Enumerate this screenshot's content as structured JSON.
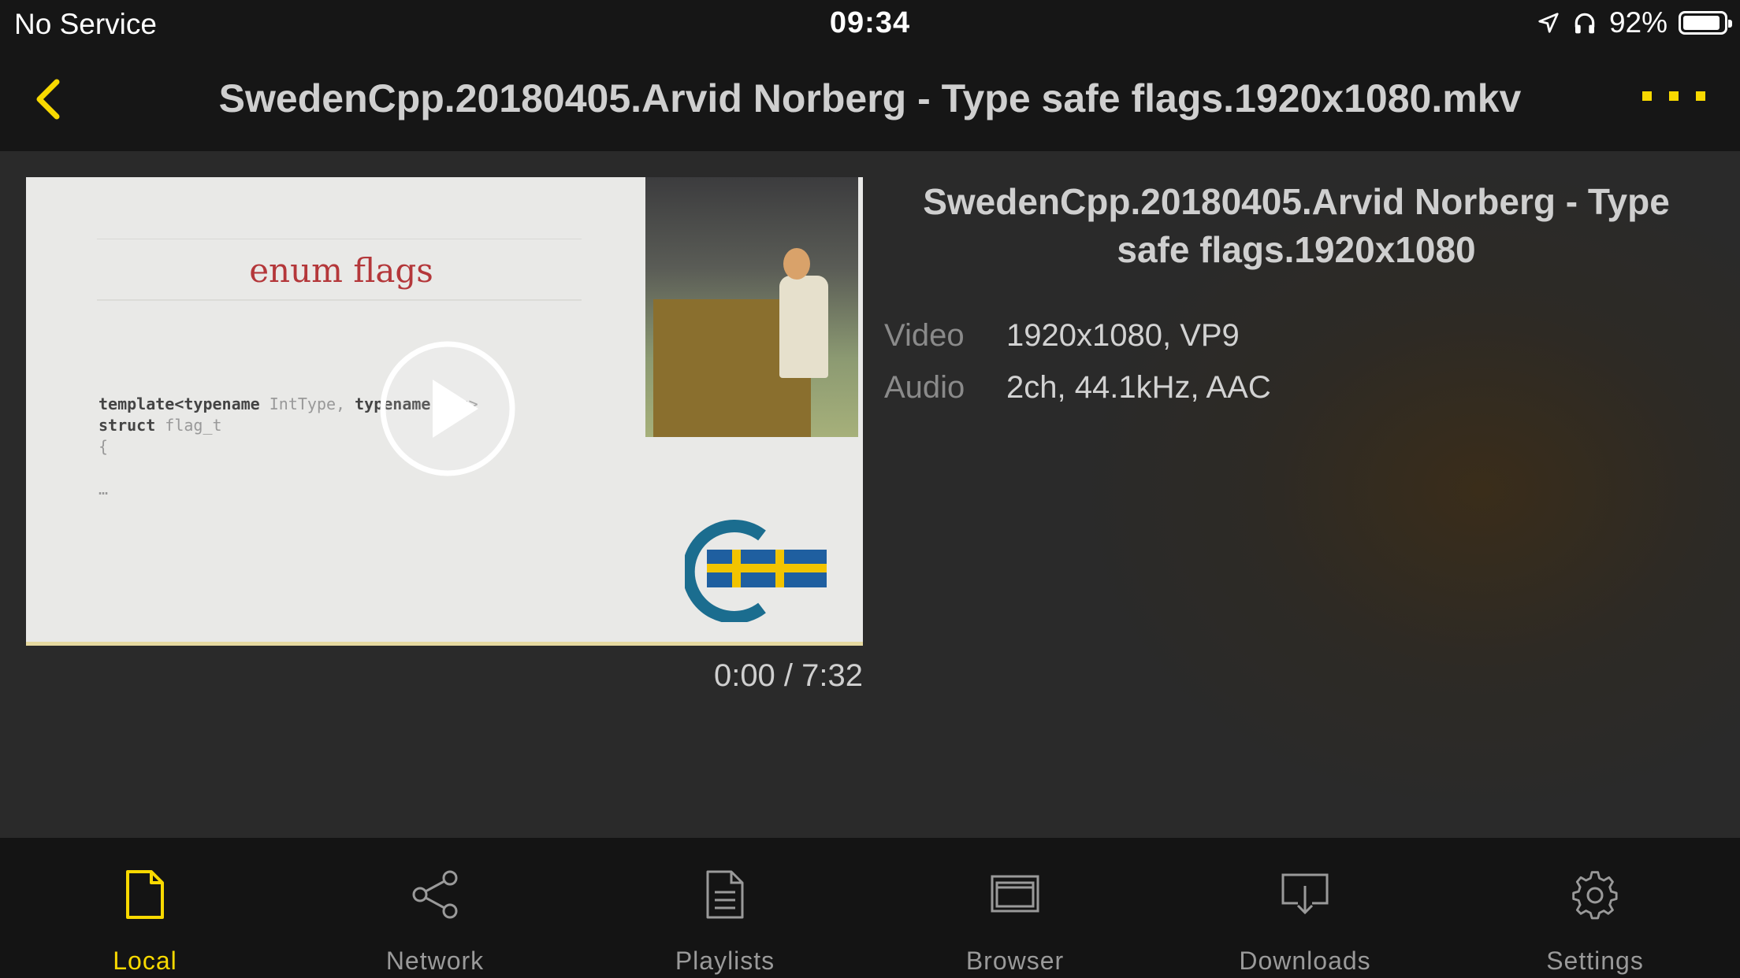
{
  "status_bar": {
    "carrier": "No Service",
    "time": "09:34",
    "battery": "92%",
    "battery_level": 0.92
  },
  "nav": {
    "title": "SwedenCpp.20180405.Arvid Norberg - Type safe flags.1920x1080.mkv"
  },
  "video": {
    "slide_title": "enum flags",
    "code_line1_a": "template<typename ",
    "code_line1_b": "IntType, ",
    "code_line1_c": "typename ",
    "code_line1_d": "Tag>",
    "code_line2_a": "struct ",
    "code_line2_b": "flag_t",
    "code_line3": "{",
    "code_line4": "…",
    "duration": "0:00 / 7:32"
  },
  "info": {
    "title": "SwedenCpp.20180405.Arvid Norberg - Type safe flags.1920x1080",
    "rows": [
      {
        "label": "Video",
        "value": "1920x1080, VP9"
      },
      {
        "label": "Audio",
        "value": "2ch, 44.1kHz, AAC"
      }
    ]
  },
  "tabs": [
    {
      "label": "Local",
      "icon": "document-icon"
    },
    {
      "label": "Network",
      "icon": "share-icon"
    },
    {
      "label": "Playlists",
      "icon": "list-document-icon"
    },
    {
      "label": "Browser",
      "icon": "browser-window-icon"
    },
    {
      "label": "Downloads",
      "icon": "download-icon"
    },
    {
      "label": "Settings",
      "icon": "gear-icon"
    }
  ],
  "colors": {
    "accent": "#f8d900",
    "bar_bg": "#161616",
    "content_bg": "#2b2b2b"
  }
}
